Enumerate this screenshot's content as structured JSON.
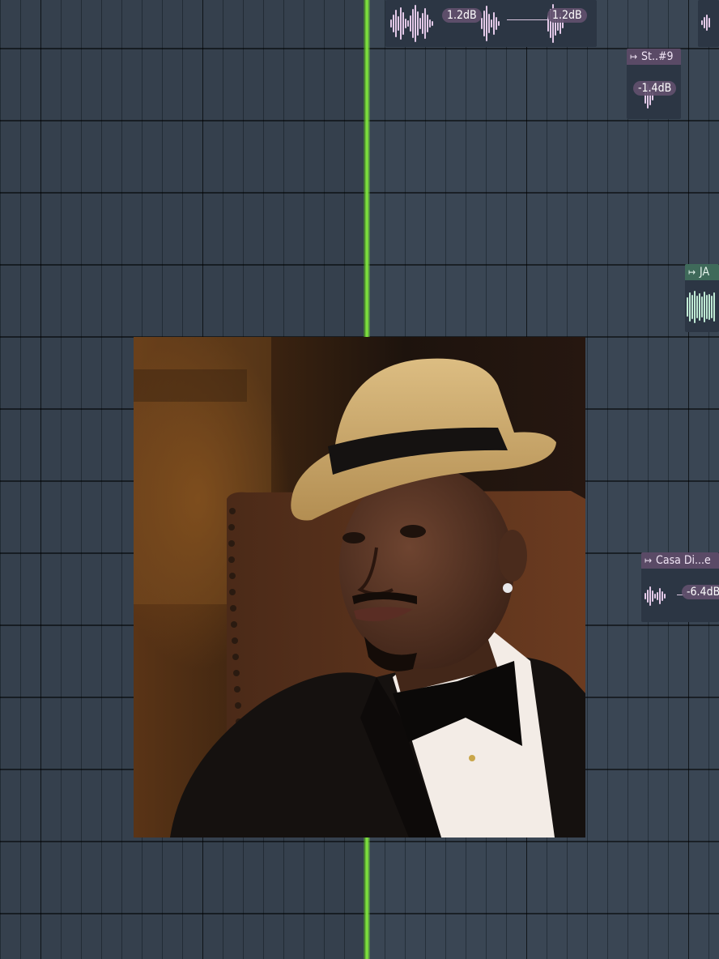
{
  "playlist": {
    "clips": [
      {
        "id": "clip-top-a",
        "volume_1": "1.2dB",
        "volume_2": "1.2dB"
      },
      {
        "id": "clip-st9",
        "label": "St..#9",
        "volume": "-1.4dB"
      },
      {
        "id": "clip-ja",
        "label": "JA"
      },
      {
        "id": "clip-casa",
        "label": "Casa Di...e",
        "volume": "-6.4dB"
      }
    ]
  },
  "icons": {
    "clip_arrow": "clip-arrow-icon"
  },
  "colors": {
    "grid_bg": "#3a4654",
    "playhead": "#7ee23c",
    "clip_purple": "#5a4a66",
    "clip_green": "#3f6a5a"
  }
}
